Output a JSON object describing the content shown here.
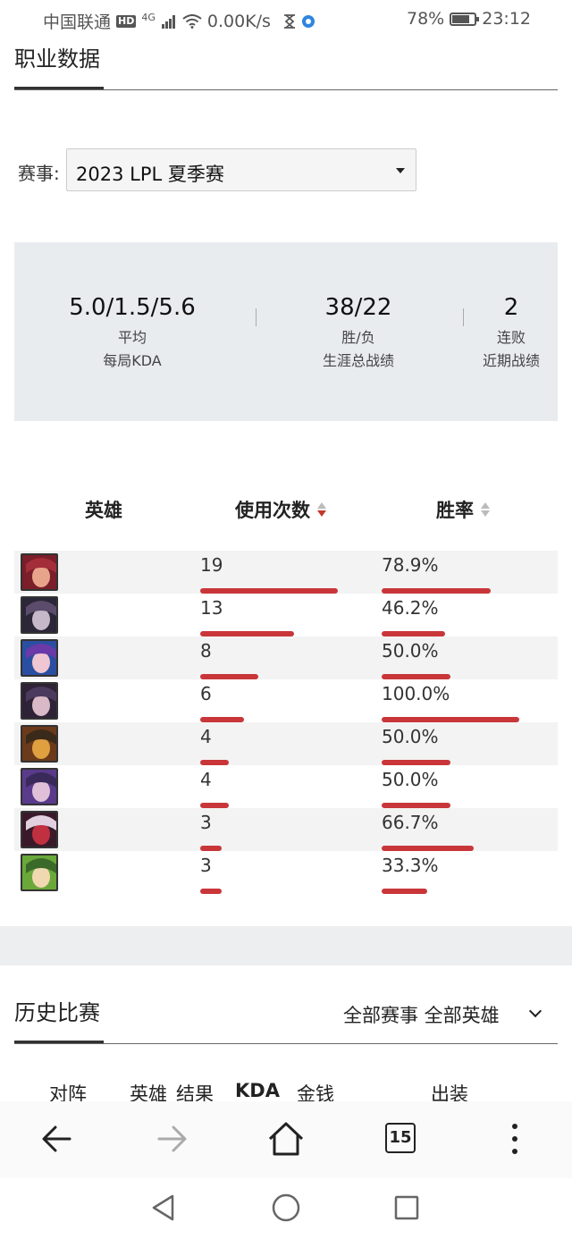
{
  "status_bar": {
    "carrier": "中国联通",
    "hd": "HD",
    "network": "4G",
    "speed": "0.00K/s",
    "battery_level": 78,
    "battery": "78%",
    "time": "23:12"
  },
  "career": {
    "title": "职业数据",
    "event_label": "赛事:",
    "event_value": "2023 LPL 夏季赛",
    "stats": [
      {
        "value": "5.0/1.5/5.6",
        "label1": "平均",
        "label2": "每局KDA"
      },
      {
        "value": "38/22",
        "label1": "胜/负",
        "label2": "生涯总战绩"
      },
      {
        "value": "2",
        "label1": "连败",
        "label2": "近期战绩"
      }
    ]
  },
  "hero_table": {
    "headers": {
      "hero": "英雄",
      "uses": "使用次数",
      "winrate": "胜率"
    },
    "rows": [
      {
        "avatar": "hero-avatar-red-hair",
        "uses": "19",
        "uses_num": 19,
        "winrate": "78.9%",
        "winrate_num": 78.9
      },
      {
        "avatar": "hero-avatar-dark",
        "uses": "13",
        "uses_num": 13,
        "winrate": "46.2%",
        "winrate_num": 46.2
      },
      {
        "avatar": "hero-avatar-blue-hair",
        "uses": "8",
        "uses_num": 8,
        "winrate": "50.0%",
        "winrate_num": 50.0
      },
      {
        "avatar": "hero-avatar-purple",
        "uses": "6",
        "uses_num": 6,
        "winrate": "100.0%",
        "winrate_num": 100.0
      },
      {
        "avatar": "hero-avatar-yordle",
        "uses": "4",
        "uses_num": 4,
        "winrate": "50.0%",
        "winrate_num": 50.0
      },
      {
        "avatar": "hero-avatar-violet",
        "uses": "4",
        "uses_num": 4,
        "winrate": "50.0%",
        "winrate_num": 50.0
      },
      {
        "avatar": "hero-avatar-crimson",
        "uses": "3",
        "uses_num": 3,
        "winrate": "66.7%",
        "winrate_num": 66.7
      },
      {
        "avatar": "hero-avatar-green-hair",
        "uses": "3",
        "uses_num": 3,
        "winrate": "33.3%",
        "winrate_num": 33.3
      }
    ]
  },
  "history": {
    "title": "历史比赛",
    "filter": "全部赛事 全部英雄",
    "columns": [
      "对阵",
      "英雄",
      "结果",
      "KDA",
      "金钱",
      "出装"
    ]
  },
  "browser": {
    "tab_count": "15"
  },
  "colors": {
    "accent_red": "#c9363a",
    "panel_gray": "#e9ecef"
  }
}
